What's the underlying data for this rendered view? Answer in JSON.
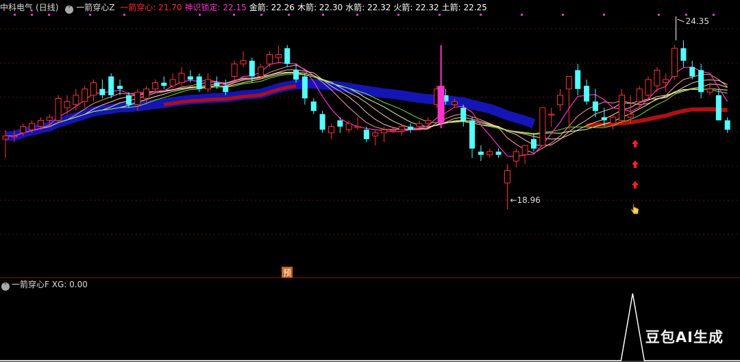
{
  "header": {
    "stock_name": "中科电气",
    "period": "(日线)",
    "indicator": "一箭穿心Z",
    "items": [
      {
        "label": "一箭穿心:",
        "value": "21.70",
        "color": "#ff2a2a"
      },
      {
        "label": "神识锁定:",
        "value": "22.15",
        "color": "#ff33cc"
      },
      {
        "label": "金箭:",
        "value": "22.26",
        "color": "#ffffff"
      },
      {
        "label": "木箭:",
        "value": "22.30",
        "color": "#ffffff"
      },
      {
        "label": "水箭:",
        "value": "22.32",
        "color": "#ffffff"
      },
      {
        "label": "火箭:",
        "value": "22.32",
        "color": "#ffffff"
      },
      {
        "label": "土箭:",
        "value": "22.25",
        "color": "#ffffff"
      }
    ]
  },
  "sub_header": {
    "indicator": "一箭穿心F",
    "xg_label": "XG:",
    "xg_value": "0.00"
  },
  "annotations": {
    "high_label": "24.35",
    "low_label": "←18.96",
    "badge": "预"
  },
  "watermark": "豆包AI生成",
  "colors": {
    "up": "#ff3333",
    "down": "#54ffff",
    "blue_ma": "#1515b5",
    "red_ma": "#b01010",
    "magenta": "#ff33cc",
    "green_ma": "#7fe040"
  },
  "chart_data": {
    "type": "candlestick",
    "title": "中科电气 (日线)",
    "ylim": [
      17.0,
      25.2
    ],
    "annotations": {
      "max": 24.35,
      "min": 18.96
    },
    "candles": [
      [
        21.2,
        21.5,
        20.6,
        21.3
      ],
      [
        21.3,
        21.5,
        21.1,
        21.3
      ],
      [
        21.4,
        21.7,
        21.3,
        21.6
      ],
      [
        21.5,
        21.8,
        21.4,
        21.7
      ],
      [
        21.6,
        21.9,
        21.5,
        21.8
      ],
      [
        21.8,
        22.0,
        21.6,
        21.9
      ],
      [
        21.8,
        22.6,
        21.7,
        22.5
      ],
      [
        22.2,
        22.6,
        22.0,
        22.4
      ],
      [
        22.3,
        22.8,
        22.1,
        22.6
      ],
      [
        22.4,
        22.9,
        22.2,
        22.8
      ],
      [
        22.6,
        23.1,
        22.4,
        23.0
      ],
      [
        22.8,
        23.1,
        22.5,
        22.6
      ],
      [
        23.2,
        23.3,
        22.5,
        22.6
      ],
      [
        22.9,
        23.1,
        22.6,
        22.8
      ],
      [
        22.6,
        22.7,
        22.2,
        22.3
      ],
      [
        22.3,
        22.8,
        22.1,
        22.7
      ],
      [
        22.5,
        22.9,
        22.3,
        22.8
      ],
      [
        22.8,
        23.1,
        22.7,
        23.0
      ],
      [
        23.0,
        23.2,
        22.8,
        22.9
      ],
      [
        22.9,
        23.3,
        22.8,
        23.1
      ],
      [
        23.0,
        23.5,
        22.9,
        23.3
      ],
      [
        23.2,
        23.4,
        23.0,
        23.1
      ],
      [
        23.2,
        23.3,
        22.7,
        22.8
      ],
      [
        22.8,
        23.3,
        22.7,
        23.1
      ],
      [
        23.0,
        23.2,
        22.8,
        22.9
      ],
      [
        22.9,
        23.1,
        22.6,
        22.7
      ],
      [
        23.2,
        23.7,
        23.0,
        23.6
      ],
      [
        23.6,
        24.0,
        23.5,
        23.7
      ],
      [
        23.7,
        23.8,
        23.0,
        23.2
      ],
      [
        23.2,
        23.6,
        23.1,
        23.5
      ],
      [
        23.6,
        24.0,
        23.5,
        23.9
      ],
      [
        23.8,
        24.2,
        23.6,
        23.9
      ],
      [
        24.1,
        24.2,
        23.5,
        23.6
      ],
      [
        23.4,
        23.6,
        23.0,
        23.1
      ],
      [
        23.2,
        23.3,
        22.3,
        22.5
      ],
      [
        22.4,
        22.5,
        22.0,
        22.1
      ],
      [
        22.0,
        22.1,
        21.4,
        21.5
      ],
      [
        21.4,
        21.7,
        21.2,
        21.6
      ],
      [
        21.8,
        21.9,
        21.4,
        21.6
      ],
      [
        21.5,
        21.8,
        21.4,
        21.7
      ],
      [
        21.6,
        21.9,
        21.5,
        21.6
      ],
      [
        21.5,
        21.6,
        21.1,
        21.2
      ],
      [
        21.3,
        21.5,
        21.0,
        21.4
      ],
      [
        21.4,
        21.6,
        21.1,
        21.5
      ],
      [
        21.5,
        21.6,
        21.4,
        21.5
      ],
      [
        21.5,
        21.7,
        21.3,
        21.6
      ],
      [
        21.6,
        21.7,
        21.4,
        21.5
      ],
      [
        21.6,
        21.8,
        21.5,
        21.7
      ],
      [
        21.7,
        21.9,
        21.6,
        21.8
      ],
      [
        22.3,
        22.9,
        22.2,
        22.8
      ],
      [
        22.6,
        22.8,
        22.3,
        22.4
      ],
      [
        22.3,
        22.5,
        22.2,
        22.4
      ],
      [
        22.2,
        22.3,
        21.6,
        21.8
      ],
      [
        21.8,
        21.9,
        20.6,
        20.9
      ],
      [
        20.8,
        21.0,
        20.5,
        20.7
      ],
      [
        20.7,
        20.9,
        20.6,
        20.8
      ],
      [
        20.8,
        20.9,
        20.6,
        20.7
      ],
      [
        19.8,
        20.4,
        18.96,
        20.2
      ],
      [
        20.5,
        20.9,
        20.3,
        20.8
      ],
      [
        20.7,
        21.0,
        20.4,
        21.0
      ],
      [
        21.2,
        21.4,
        20.8,
        20.9
      ],
      [
        21.0,
        22.2,
        21.0,
        22.2
      ],
      [
        22.0,
        22.2,
        21.6,
        22.0
      ],
      [
        22.3,
        22.8,
        22.1,
        22.6
      ],
      [
        22.8,
        23.2,
        21.5,
        23.2
      ],
      [
        23.4,
        23.6,
        22.6,
        22.8
      ],
      [
        22.9,
        23.1,
        22.3,
        22.4
      ],
      [
        22.4,
        22.8,
        21.9,
        22.1
      ],
      [
        21.9,
        22.2,
        21.6,
        21.8
      ],
      [
        21.7,
        22.0,
        21.5,
        21.9
      ],
      [
        21.8,
        22.8,
        21.7,
        22.6
      ],
      [
        21.9,
        22.6,
        21.7,
        22.0
      ],
      [
        22.4,
        22.9,
        22.2,
        22.8
      ],
      [
        22.6,
        23.2,
        22.4,
        23.1
      ],
      [
        22.9,
        23.5,
        22.7,
        23.4
      ],
      [
        23.0,
        23.3,
        22.7,
        23.1
      ],
      [
        23.2,
        24.2,
        23.1,
        24.1
      ],
      [
        24.1,
        24.35,
        23.5,
        23.7
      ],
      [
        23.5,
        23.7,
        23.1,
        23.2
      ],
      [
        23.4,
        23.6,
        22.5,
        22.7
      ],
      [
        22.7,
        23.0,
        22.6,
        22.8
      ],
      [
        22.6,
        22.8,
        21.8,
        21.8
      ],
      [
        21.8,
        21.9,
        21.4,
        21.5
      ]
    ],
    "signal_candle": {
      "index": 49,
      "open": 22.9,
      "close": 21.7,
      "low": 21.55,
      "high": 24.2
    },
    "xg_series_peak_index": 71
  }
}
